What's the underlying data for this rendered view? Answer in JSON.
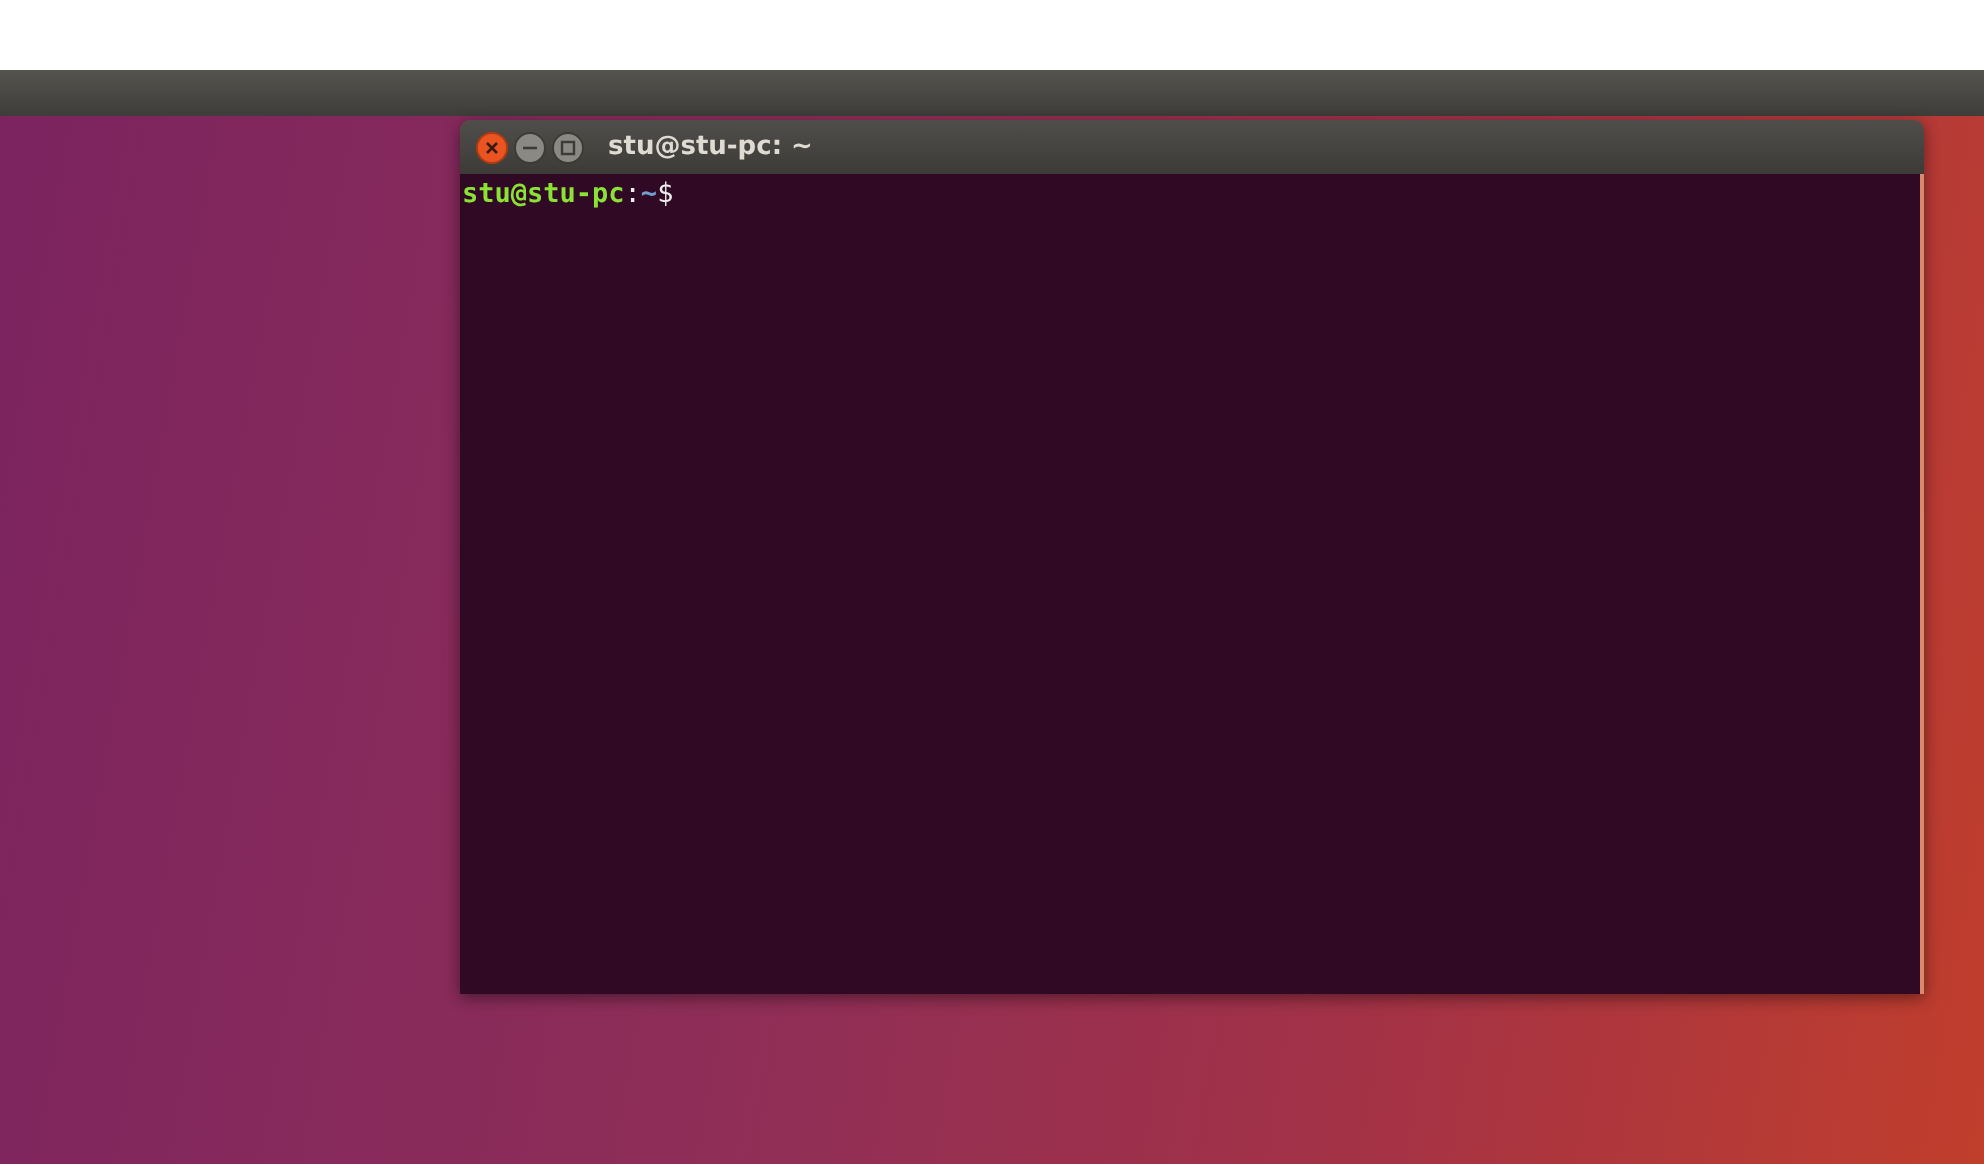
{
  "terminal_window": {
    "title": "stu@stu-pc: ~",
    "prompt": {
      "user_host": "stu@stu-pc",
      "separator": ":",
      "path": "~",
      "symbol": "$"
    }
  }
}
